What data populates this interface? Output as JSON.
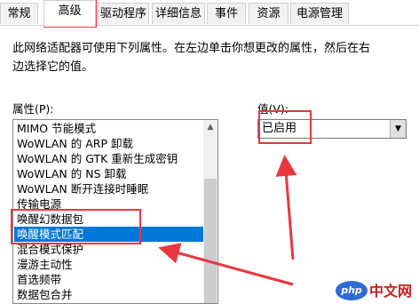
{
  "tabs": [
    {
      "label": "常规",
      "active": false
    },
    {
      "label": "高级",
      "active": true
    },
    {
      "label": "驱动程序",
      "active": false
    },
    {
      "label": "详细信息",
      "active": false
    },
    {
      "label": "事件",
      "active": false
    },
    {
      "label": "资源",
      "active": false
    },
    {
      "label": "电源管理",
      "active": false
    }
  ],
  "description": {
    "line1": "此网络适配器可使用下列属性。在左边单击你想更改的属性，然后在右",
    "line2": "边选择它的值。"
  },
  "properties": {
    "label": "属性(P):",
    "items": [
      "MIMO 节能模式",
      "WoWLAN 的 ARP 卸载",
      "WoWLAN 的 GTK 重新生成密钥",
      "WoWLAN 的 NS 卸载",
      "WoWLAN 断开连接时睡眠",
      "传输电源",
      "唤醒幻数据包",
      "唤醒模式匹配",
      "混合模式保护",
      "漫游主动性",
      "首选频带",
      "数据包合并"
    ],
    "selected": "唤醒模式匹配"
  },
  "value": {
    "label": "值(V):",
    "selected": "已启用"
  },
  "icons": {
    "scroll_up": "scroll-up-arrow-icon",
    "dropdown": "chevron-down-icon"
  },
  "colors": {
    "annotation": "#e8383d",
    "selection": "#0078d7"
  },
  "watermark": {
    "logo": "php",
    "text": "中文网"
  }
}
